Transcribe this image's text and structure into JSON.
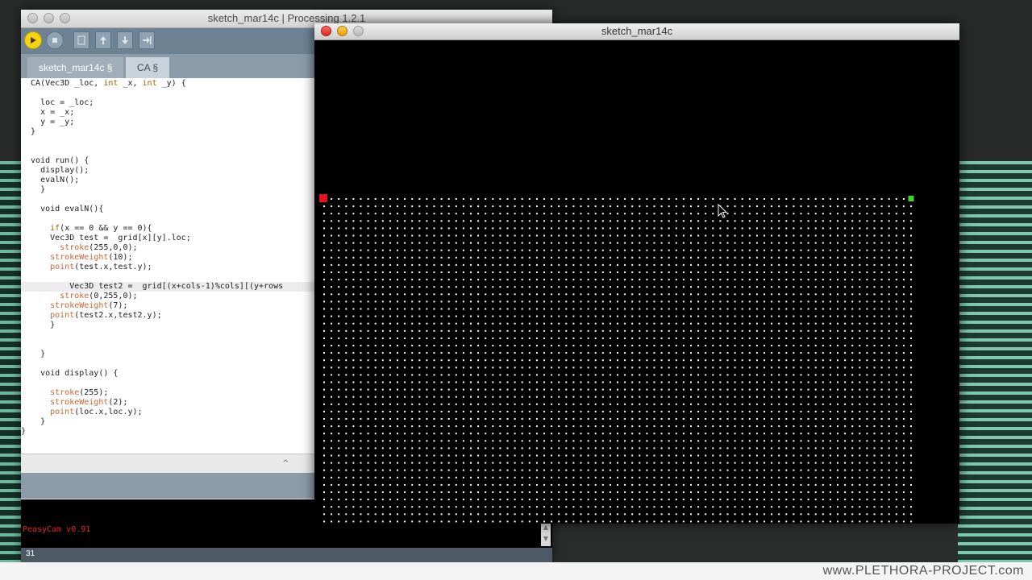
{
  "editor": {
    "title": "sketch_mar14c | Processing 1.2.1",
    "tabs": [
      {
        "label": "sketch_mar14c §"
      },
      {
        "label": "CA §"
      }
    ],
    "console_text": "PeasyCam v0.91",
    "line_number": "31",
    "toolbar_icons": [
      "run-icon",
      "stop-icon",
      "new-icon",
      "open-icon",
      "save-icon",
      "export-icon"
    ]
  },
  "code": {
    "lines": [
      "  CA(Vec3D _loc, int _x, int _y) {",
      "",
      "    loc = _loc;",
      "    x = _x;",
      "    y = _y;",
      "  }",
      "",
      "",
      "  void run() {",
      "    display();",
      "    evalN();",
      "    }",
      "",
      "    void evalN(){",
      "",
      "      if(x == 0 && y == 0){",
      "      Vec3D test =  grid[x][y].loc;",
      "        stroke(255,0,0);",
      "      strokeWeight(10);",
      "      point(test.x,test.y);",
      "",
      "          Vec3D test2 =  grid[(x+cols-1)%cols][(y+rows",
      "        stroke(0,255,0);",
      "      strokeWeight(7);",
      "      point(test2.x,test2.y);",
      "      }",
      "",
      "",
      "    }",
      "",
      "    void display() {",
      "",
      "      stroke(255);",
      "      strokeWeight(2);",
      "      point(loc.x,loc.y);",
      "    }",
      "}"
    ],
    "highlight_line": 21
  },
  "sketch": {
    "title": "sketch_mar14c",
    "grid": {
      "cols": 81,
      "rows": 45,
      "dot_color": "#ffffff",
      "red_marker": "#e8101e",
      "green_marker": "#3ad63a"
    }
  },
  "watermark": "www.PLETHORA-PROJECT.com",
  "colors": {
    "toolbar": "#6d8394",
    "run_button": "#f5d214",
    "console_text": "#e0242c"
  }
}
